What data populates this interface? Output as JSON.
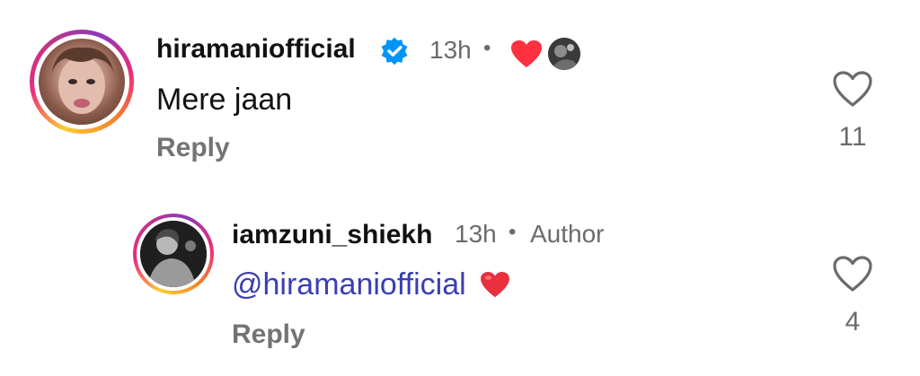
{
  "comments": [
    {
      "username": "hiramaniofficial",
      "verified": true,
      "time": "13h",
      "separator": "•",
      "text": "Mere jaan",
      "reply_label": "Reply",
      "like_count": "11"
    },
    {
      "username": "iamzuni_shiekh",
      "time": "13h",
      "separator": "•",
      "author_badge": "Author",
      "mention": "@hiramaniofficial",
      "text_suffix": "❤️",
      "reply_label": "Reply",
      "like_count": "4"
    }
  ],
  "colors": {
    "heart_red": "#ff3040",
    "mention_blue": "#3a3fb0",
    "verified_blue": "#0095f6",
    "muted_gray": "#737373"
  },
  "icons": [
    "verified-badge-icon",
    "heart-reaction-icon",
    "like-heart-icon"
  ]
}
